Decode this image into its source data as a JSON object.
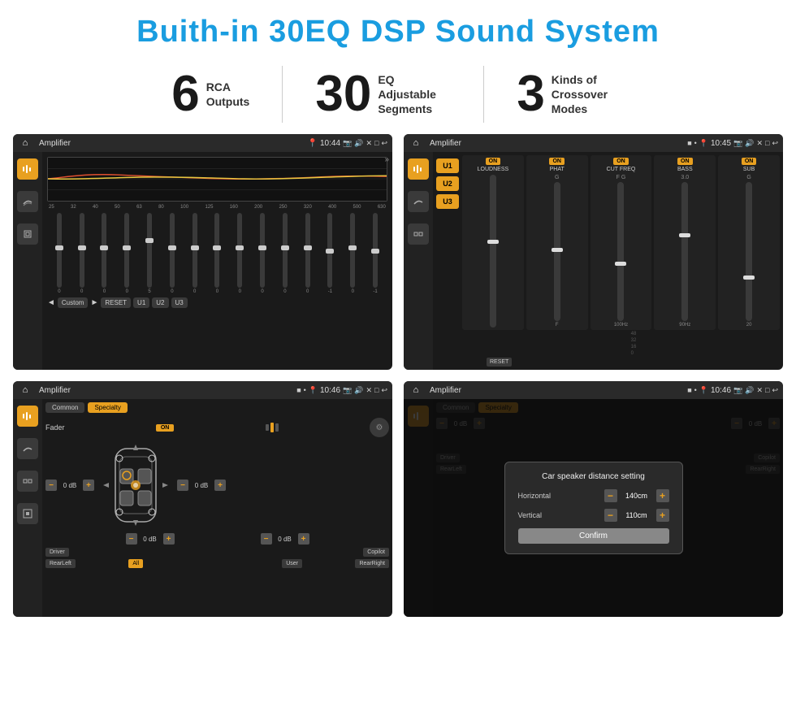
{
  "page": {
    "title": "Buith-in 30EQ DSP Sound System"
  },
  "stats": [
    {
      "number": "6",
      "label": "RCA\nOutputs"
    },
    {
      "number": "30",
      "label": "EQ Adjustable\nSegments"
    },
    {
      "number": "3",
      "label": "Kinds of\nCrossover Modes"
    }
  ],
  "screens": [
    {
      "id": "eq-screen",
      "title": "Amplifier",
      "time": "10:44",
      "type": "eq"
    },
    {
      "id": "crossover-screen",
      "title": "Amplifier",
      "time": "10:45",
      "type": "crossover"
    },
    {
      "id": "fader-screen",
      "title": "Amplifier",
      "time": "10:46",
      "type": "fader"
    },
    {
      "id": "dialog-screen",
      "title": "Amplifier",
      "time": "10:46",
      "type": "dialog"
    }
  ],
  "eq": {
    "frequencies": [
      "25",
      "32",
      "40",
      "50",
      "63",
      "80",
      "100",
      "125",
      "160",
      "200",
      "250",
      "320",
      "400",
      "500",
      "630"
    ],
    "values": [
      "0",
      "0",
      "0",
      "0",
      "5",
      "0",
      "0",
      "0",
      "0",
      "0",
      "0",
      "0",
      "-1",
      "0",
      "-1"
    ],
    "preset": "Custom",
    "buttons": [
      "RESET",
      "U1",
      "U2",
      "U3"
    ]
  },
  "crossover": {
    "u_buttons": [
      "U1",
      "U2",
      "U3"
    ],
    "modules": [
      "LOUDNESS",
      "PHAT",
      "CUT FREQ",
      "BASS",
      "SUB"
    ],
    "reset_label": "RESET"
  },
  "fader": {
    "tabs": [
      "Common",
      "Specialty"
    ],
    "fader_label": "Fader",
    "on_label": "ON",
    "db_values": [
      "0 dB",
      "0 dB",
      "0 dB",
      "0 dB"
    ],
    "positions": [
      "Driver",
      "Copilot",
      "RearLeft",
      "All",
      "User",
      "RearRight"
    ]
  },
  "dialog": {
    "title": "Car speaker distance setting",
    "horizontal_label": "Horizontal",
    "horizontal_value": "140cm",
    "vertical_label": "Vertical",
    "vertical_value": "110cm",
    "confirm_label": "Confirm",
    "db_values": [
      "0 dB",
      "0 dB"
    ]
  }
}
